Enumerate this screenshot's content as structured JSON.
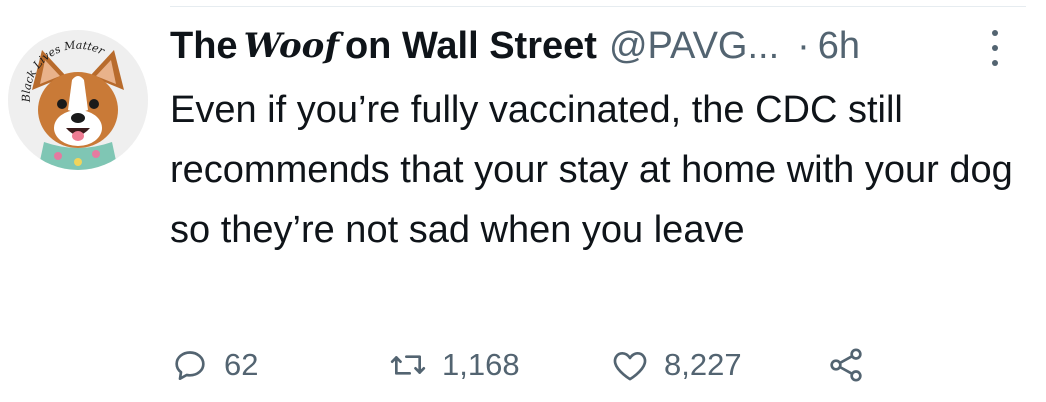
{
  "author": {
    "name_prefix": "The",
    "name_script": "Woof",
    "name_suffix": "on Wall Street",
    "handle": "@PAVG...",
    "separator": "·",
    "time": "6h",
    "avatar_text": "Black Lives Matter"
  },
  "tweet": {
    "text": "Even if you’re fully vaccinated, the CDC still recommends that your stay at home with your dog so they’re not sad when you leave"
  },
  "actions": {
    "replies": "62",
    "retweets": "1,168",
    "likes": "8,227"
  },
  "icons": {
    "reply": "reply-icon",
    "retweet": "retweet-icon",
    "like": "heart-icon",
    "share": "share-icon",
    "more": "more-vertical-icon"
  },
  "colors": {
    "text": "#0f1419",
    "secondary": "#536471",
    "divider": "#e6ecf0"
  }
}
